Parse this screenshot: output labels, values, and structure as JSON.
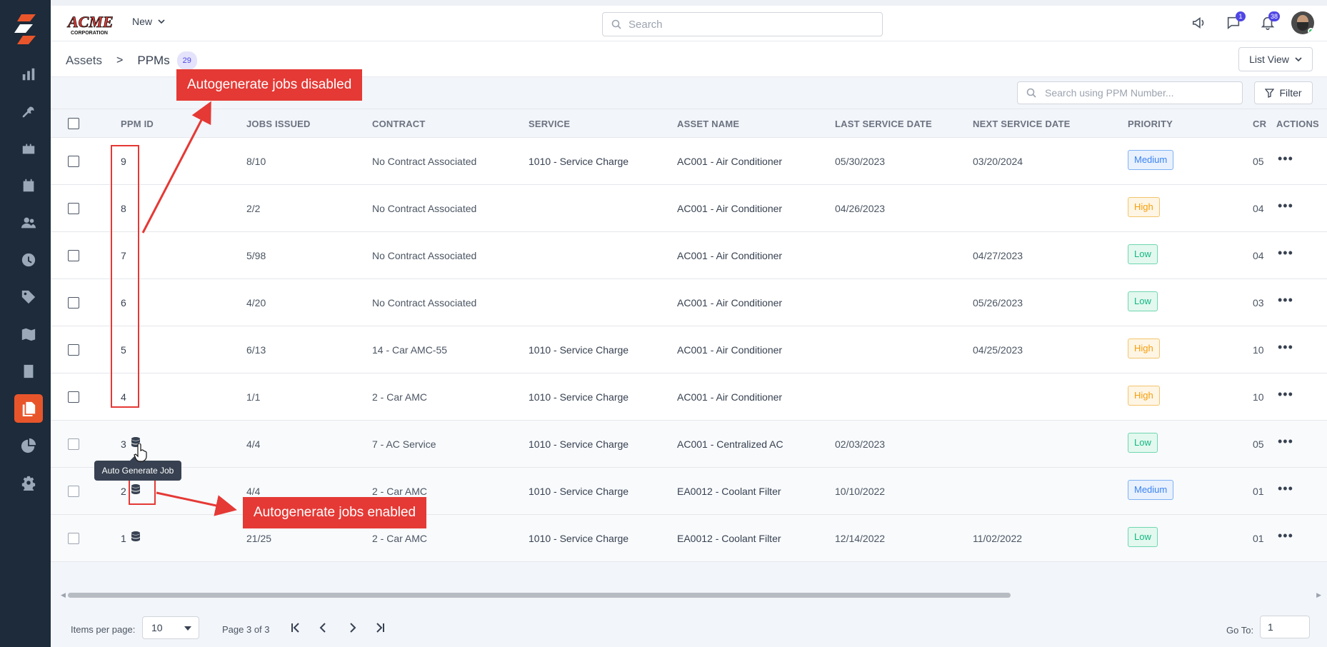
{
  "header": {
    "new_label": "New",
    "search_placeholder": "Search",
    "chat_badge": "1",
    "notif_badge": "38"
  },
  "breadcrumb": {
    "root": "Assets",
    "sep": ">",
    "current": "PPMs",
    "count": "29"
  },
  "view_button": "List View",
  "toolbar": {
    "ppm_search_placeholder": "Search using PPM Number...",
    "filter_label": "Filter"
  },
  "columns": [
    "PPM ID",
    "JOBS ISSUED",
    "CONTRACT",
    "SERVICE",
    "ASSET NAME",
    "LAST SERVICE DATE",
    "NEXT SERVICE DATE",
    "PRIORITY",
    "CR",
    "ACTIONS"
  ],
  "rows": [
    {
      "id": "9",
      "jobs": "8/10",
      "contract": "No Contract Associated",
      "service": "1010 - Service Charge",
      "asset": "AC001 - Air Conditioner",
      "last": "05/30/2023",
      "next": "03/20/2024",
      "priority": "Medium",
      "cr": "05",
      "auto": false
    },
    {
      "id": "8",
      "jobs": "2/2",
      "contract": "No Contract Associated",
      "service": "",
      "asset": "AC001 - Air Conditioner",
      "last": "04/26/2023",
      "next": "",
      "priority": "High",
      "cr": "04",
      "auto": false
    },
    {
      "id": "7",
      "jobs": "5/98",
      "contract": "No Contract Associated",
      "service": "",
      "asset": "AC001 - Air Conditioner",
      "last": "",
      "next": "04/27/2023",
      "priority": "Low",
      "cr": "04",
      "auto": false
    },
    {
      "id": "6",
      "jobs": "4/20",
      "contract": "No Contract Associated",
      "service": "",
      "asset": "AC001 - Air Conditioner",
      "last": "",
      "next": "05/26/2023",
      "priority": "Low",
      "cr": "03",
      "auto": false
    },
    {
      "id": "5",
      "jobs": "6/13",
      "contract": "14 - Car AMC-55",
      "service": "1010 - Service Charge",
      "asset": "AC001 - Air Conditioner",
      "last": "",
      "next": "04/25/2023",
      "priority": "High",
      "cr": "10",
      "auto": false
    },
    {
      "id": "4",
      "jobs": "1/1",
      "contract": "2 - Car AMC",
      "service": "1010 - Service Charge",
      "asset": "AC001 - Air Conditioner",
      "last": "",
      "next": "",
      "priority": "High",
      "cr": "10",
      "auto": false
    },
    {
      "id": "3",
      "jobs": "4/4",
      "contract": "7 - AC Service",
      "service": "1010 - Service Charge",
      "asset": "AC001 - Centralized AC",
      "last": "02/03/2023",
      "next": "",
      "priority": "Low",
      "cr": "05",
      "auto": true
    },
    {
      "id": "2",
      "jobs": "4/4",
      "contract": "2 - Car AMC",
      "service": "1010 - Service Charge",
      "asset": "EA0012 - Coolant Filter",
      "last": "10/10/2022",
      "next": "",
      "priority": "Medium",
      "cr": "01",
      "auto": true
    },
    {
      "id": "1",
      "jobs": "21/25",
      "contract": "2 - Car AMC",
      "service": "1010 - Service Charge",
      "asset": "EA0012 - Coolant Filter",
      "last": "12/14/2022",
      "next": "11/02/2022",
      "priority": "Low",
      "cr": "01",
      "auto": true
    }
  ],
  "tooltip": "Auto Generate Job",
  "annotations": {
    "disabled": "Autogenerate jobs disabled",
    "enabled": "Autogenerate jobs enabled"
  },
  "pager": {
    "items_label": "Items per page:",
    "items_value": "10",
    "page_label": "Page 3 of 3",
    "goto_label": "Go To:",
    "goto_value": "1"
  },
  "colors": {
    "sidebar": "#1d2b3a",
    "accent": "#e8552b",
    "annotation": "#e53935"
  }
}
